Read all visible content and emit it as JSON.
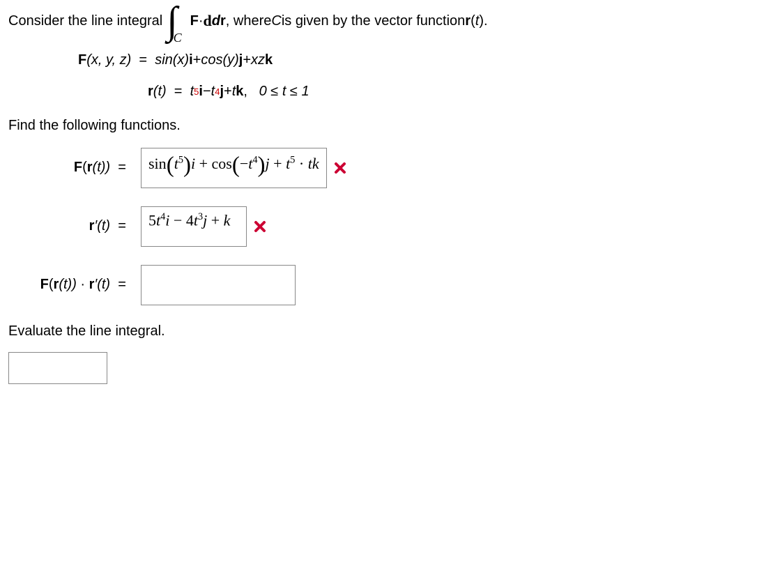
{
  "intro": {
    "part1": "Consider the line integral",
    "integral_sub": "C",
    "integrand_F": "F",
    "integrand_dot": " · ",
    "integrand_dr": "dr",
    "part2": ", where ",
    "C": "C",
    "part3": " is given by the vector function ",
    "r": "r",
    "paren_t": "(",
    "t": "t",
    "paren_close": ").",
    "period": ""
  },
  "defF": {
    "lhs_F": "F",
    "lhs_args": "(x, y, z)",
    "eq": "  =  ",
    "rhs": {
      "t1": "sin(x)",
      "i": "i",
      "plus1": " + ",
      "t2": "cos(y)",
      "j": "j",
      "plus2": " + ",
      "t3": "xz",
      "k": "k"
    }
  },
  "defr": {
    "lhs_r": "r",
    "lhs_t": "(t)",
    "eq": "  =  ",
    "rhs": {
      "t1a": "t",
      "t1exp": "5",
      "i": "i",
      "minus": " − ",
      "t2a": "t",
      "t2exp": "4",
      "j": "j",
      "plus": " + ",
      "t3": "t",
      "k": "k",
      "comma": ",",
      "domain": "   0 ≤ t ≤ 1"
    }
  },
  "prompt2": "Find the following functions.",
  "ans1": {
    "label_F": "F",
    "label_open": "(",
    "label_r": "r",
    "label_t": "(t))",
    "eq": "  =  ",
    "expr": {
      "sin": "sin",
      "t1": "t",
      "e1": "5",
      "i": "i",
      "plus1": " + ",
      "cos": "cos",
      "neg": "−",
      "t2": "t",
      "e2": "4",
      "j": "j",
      "plus2": " + ",
      "t3": "t",
      "e3": "5",
      "dot": " · ",
      "tk": "tk"
    }
  },
  "ans2": {
    "label_r": "r",
    "label_prime": "′(t)",
    "eq": "  =  ",
    "expr": {
      "c1": "5",
      "t1": "t",
      "e1": "4",
      "i": "i",
      "minus": " − ",
      "c2": "4",
      "t2": "t",
      "e2": "3",
      "j": "j",
      "plus": " + ",
      "k": "k"
    }
  },
  "ans3": {
    "label_F": "F",
    "label_open": "(",
    "label_r": "r",
    "label_t1": "(t))",
    "dot": " · ",
    "label_r2": "r",
    "label_prime": "′(t)",
    "eq": "  =  "
  },
  "prompt3": "Evaluate the line integral.",
  "status": {
    "wrong1": "incorrect",
    "wrong2": "incorrect"
  },
  "chart_data": {
    "type": "table",
    "title": "Line integral problem data",
    "F": "sin(x) i + cos(y) j + xz k",
    "r(t)": "t^5 i - t^4 j + t k",
    "t_domain": [
      0,
      1
    ],
    "student_answers": {
      "F(r(t))": "sin(t^5) i + cos(-t^4) j + t^5 * t k",
      "F(r(t))_status": "incorrect",
      "r'(t)": "5t^4 i - 4t^3 j + k",
      "r'(t)_status": "incorrect",
      "F(r(t))·r'(t)": "",
      "integral_value": ""
    }
  }
}
